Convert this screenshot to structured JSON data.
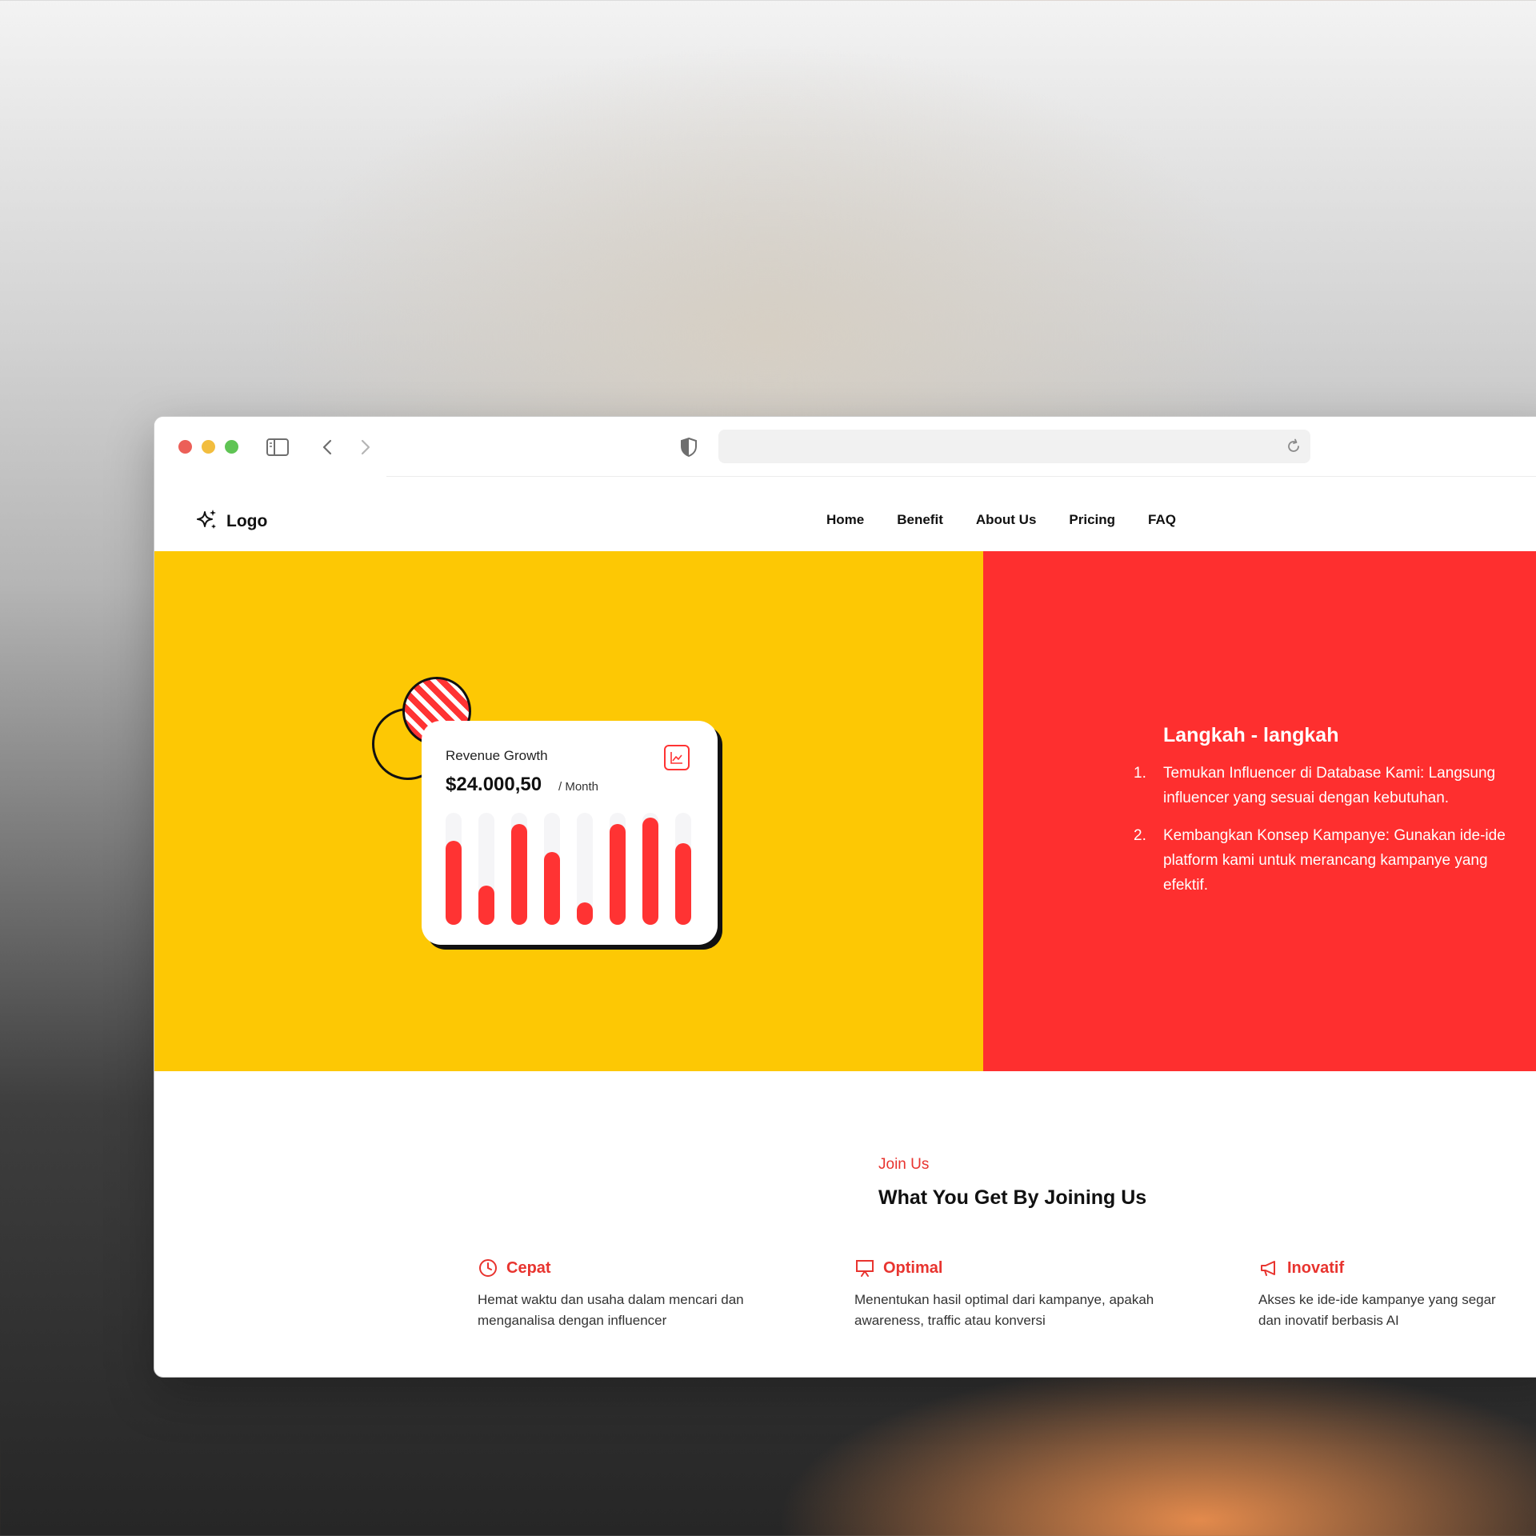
{
  "browser": {
    "icons": [
      "sidebar-icon",
      "back-icon",
      "forward-icon",
      "shield-icon",
      "reload-icon"
    ],
    "url": ""
  },
  "nav": {
    "logo_text": "Logo",
    "logo_icon": "sparkle-icon",
    "items": [
      {
        "label": "Home"
      },
      {
        "label": "Benefit"
      },
      {
        "label": "About Us"
      },
      {
        "label": "Pricing"
      },
      {
        "label": "FAQ"
      }
    ]
  },
  "hero": {
    "card": {
      "title": "Revenue Growth",
      "amount": "$24.000,50",
      "unit": "/ Month",
      "icon": "line-chart-icon"
    },
    "chart_data": {
      "type": "bar",
      "values": [
        0.75,
        0.35,
        0.9,
        0.65,
        0.2,
        0.9,
        0.96,
        0.73
      ]
    },
    "steps": {
      "heading": "Langkah - langkah",
      "items": [
        {
          "num": "1.",
          "line1": "Temukan Influencer di Database Kami: Langsung",
          "line2": "influencer yang sesuai dengan kebutuhan."
        },
        {
          "num": "2.",
          "line1": "Kembangkan Konsep Kampanye: Gunakan ide-ide",
          "line2": "platform kami untuk merancang kampanye yang",
          "line3": "efektif."
        }
      ]
    }
  },
  "benefits": {
    "eyebrow": "Join Us",
    "title": "What You Get By Joining Us",
    "features": [
      {
        "icon": "clock-icon",
        "title": "Cepat",
        "desc": "Hemat waktu dan usaha dalam mencari dan\nmenganalisa dengan influencer"
      },
      {
        "icon": "presentation-icon",
        "title": "Optimal",
        "desc": "Menentukan hasil optimal dari kampanye, apakah\nawareness, traffic atau konversi"
      },
      {
        "icon": "megaphone-icon",
        "title": "Inovatif",
        "desc": "Akses ke ide-ide kampanye yang segar\ndan inovatif berbasis AI"
      }
    ]
  },
  "colors": {
    "yellow": "#fdc804",
    "red": "#fe2f2f",
    "accent": "#e8342f"
  }
}
